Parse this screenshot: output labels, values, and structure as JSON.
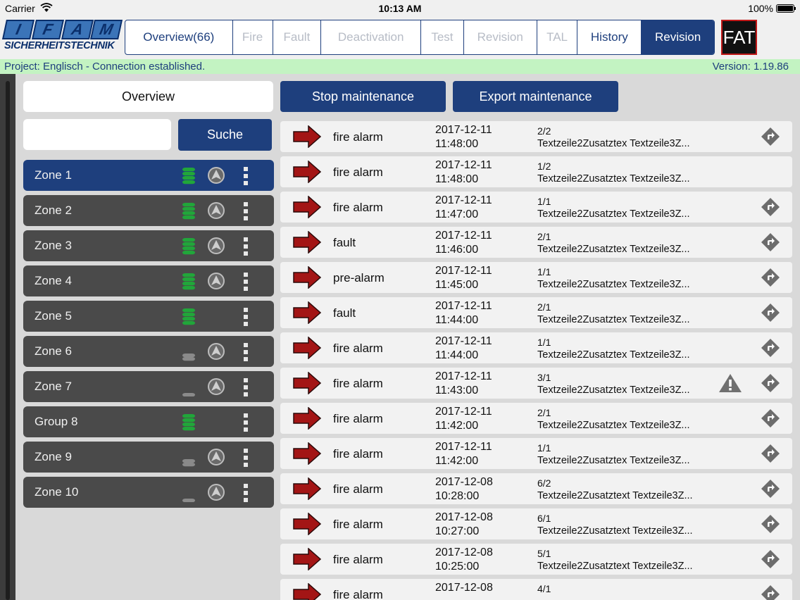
{
  "status_bar": {
    "carrier": "Carrier",
    "time": "10:13 AM",
    "battery": "100%"
  },
  "header": {
    "logo_letters": [
      "I",
      "F",
      "A",
      "M"
    ],
    "logo_subtitle": "SICHERHEITSTECHNIK",
    "fat_label": "FAT",
    "tabs": [
      {
        "label": "Overview(66)",
        "state": "active"
      },
      {
        "label": "Fire",
        "state": "disabled"
      },
      {
        "label": "Fault",
        "state": "disabled"
      },
      {
        "label": "Deactivation",
        "state": "disabled"
      },
      {
        "label": "Test",
        "state": "disabled"
      },
      {
        "label": "Revision",
        "state": "disabled"
      },
      {
        "label": "TAL",
        "state": "disabled"
      },
      {
        "label": "History",
        "state": "active"
      },
      {
        "label": "Revision",
        "state": "selected"
      }
    ]
  },
  "info_bar": {
    "project": "Project:  Englisch  -  Connection established.",
    "version": "Version: 1.19.86"
  },
  "left_panel": {
    "overview_label": "Overview",
    "search_placeholder": "",
    "search_button": "Suche",
    "zones": [
      {
        "label": "Zone 1",
        "selected": true,
        "db": "full",
        "nav": true
      },
      {
        "label": "Zone 2",
        "selected": false,
        "db": "full",
        "nav": true
      },
      {
        "label": "Zone 3",
        "selected": false,
        "db": "full",
        "nav": true
      },
      {
        "label": "Zone 4",
        "selected": false,
        "db": "full",
        "nav": true
      },
      {
        "label": "Zone 5",
        "selected": false,
        "db": "full",
        "nav": false
      },
      {
        "label": "Zone 6",
        "selected": false,
        "db": "half",
        "nav": true
      },
      {
        "label": "Zone 7",
        "selected": false,
        "db": "low",
        "nav": true
      },
      {
        "label": "Group 8",
        "selected": false,
        "db": "full",
        "nav": false
      },
      {
        "label": "Zone 9",
        "selected": false,
        "db": "half",
        "nav": true
      },
      {
        "label": "Zone 10",
        "selected": false,
        "db": "low",
        "nav": true
      }
    ]
  },
  "actions": {
    "stop": "Stop maintenance",
    "export": "Export maintenance"
  },
  "events": [
    {
      "type": "fire alarm",
      "date": "2017-12-11",
      "time": "11:48:00",
      "index": "2/2",
      "text": "Textzeile2Zusatztex  Textzeile3Z...",
      "warning": false,
      "goto": true
    },
    {
      "type": "fire alarm",
      "date": "2017-12-11",
      "time": "11:48:00",
      "index": "1/2",
      "text": "Textzeile2Zusatztex  Textzeile3Z...",
      "warning": false,
      "goto": false
    },
    {
      "type": "fire alarm",
      "date": "2017-12-11",
      "time": "11:47:00",
      "index": "1/1",
      "text": "Textzeile2Zusatztex  Textzeile3Z...",
      "warning": false,
      "goto": true
    },
    {
      "type": "fault",
      "date": "2017-12-11",
      "time": "11:46:00",
      "index": "2/1",
      "text": "Textzeile2Zusatztex  Textzeile3Z...",
      "warning": false,
      "goto": true
    },
    {
      "type": "pre-alarm",
      "date": "2017-12-11",
      "time": "11:45:00",
      "index": "1/1",
      "text": "Textzeile2Zusatztex  Textzeile3Z...",
      "warning": false,
      "goto": true
    },
    {
      "type": "fault",
      "date": "2017-12-11",
      "time": "11:44:00",
      "index": "2/1",
      "text": "Textzeile2Zusatztex  Textzeile3Z...",
      "warning": false,
      "goto": true
    },
    {
      "type": "fire alarm",
      "date": "2017-12-11",
      "time": "11:44:00",
      "index": "1/1",
      "text": "Textzeile2Zusatztex  Textzeile3Z...",
      "warning": false,
      "goto": true
    },
    {
      "type": "fire alarm",
      "date": "2017-12-11",
      "time": "11:43:00",
      "index": "3/1",
      "text": "Textzeile2Zusatztex  Textzeile3Z...",
      "warning": true,
      "goto": true
    },
    {
      "type": "fire alarm",
      "date": "2017-12-11",
      "time": "11:42:00",
      "index": "2/1",
      "text": "Textzeile2Zusatztex  Textzeile3Z...",
      "warning": false,
      "goto": true
    },
    {
      "type": "fire alarm",
      "date": "2017-12-11",
      "time": "11:42:00",
      "index": "1/1",
      "text": "Textzeile2Zusatztex  Textzeile3Z...",
      "warning": false,
      "goto": true
    },
    {
      "type": "fire alarm",
      "date": "2017-12-08",
      "time": "10:28:00",
      "index": "6/2",
      "text": "Textzeile2Zusatztext Textzeile3Z...",
      "warning": false,
      "goto": true
    },
    {
      "type": "fire alarm",
      "date": "2017-12-08",
      "time": "10:27:00",
      "index": "6/1",
      "text": "Textzeile2Zusatztext Textzeile3Z...",
      "warning": false,
      "goto": true
    },
    {
      "type": "fire alarm",
      "date": "2017-12-08",
      "time": "10:25:00",
      "index": "5/1",
      "text": "Textzeile2Zusatztext Textzeile3Z...",
      "warning": false,
      "goto": true
    },
    {
      "type": "fire alarm",
      "date": "2017-12-08",
      "time": "",
      "index": "4/1",
      "text": "",
      "warning": false,
      "goto": true
    }
  ],
  "colors": {
    "navy": "#1e3f7d",
    "zone_gray": "#4a4a4a",
    "info_green": "#c3f3c2",
    "db_green": "#21a63a",
    "arrow_red": "#a31515"
  }
}
